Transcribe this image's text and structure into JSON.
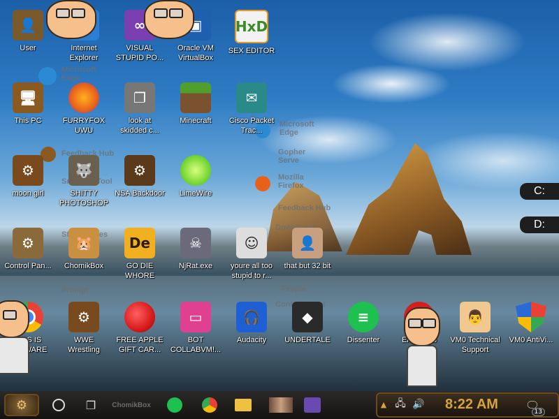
{
  "desktop_icons": [
    {
      "id": "user",
      "label": "User",
      "icon": "user-folder-icon",
      "color": "#7a5a2a"
    },
    {
      "id": "ie",
      "label": "Internet\nExplorer",
      "icon": "internet-explorer-icon",
      "color": "#2a7fd4"
    },
    {
      "id": "vs",
      "label": "VISUAL\nSTUPID PO...",
      "icon": "visual-studio-icon",
      "color": "#7a3fb0"
    },
    {
      "id": "vbox",
      "label": "Oracle VM\nVirtualBox",
      "icon": "virtualbox-icon",
      "color": "#1f5fb0"
    },
    {
      "id": "hxd",
      "label": "SEX EDITOR",
      "icon": "hex-editor-icon",
      "color": "#f2f2f2"
    },
    {
      "id": "thispc",
      "label": "This PC",
      "icon": "computer-icon",
      "color": "#8a5a20"
    },
    {
      "id": "firefox",
      "label": "FURRYFOX\nUWU",
      "icon": "firefox-icon",
      "color": "#e8611a"
    },
    {
      "id": "skidded",
      "label": "look at\nskidded c...",
      "icon": "stacked-windows-icon",
      "color": "#777777"
    },
    {
      "id": "minecraft",
      "label": "Minecraft",
      "icon": "grass-block-icon",
      "color": "#4f7f2a"
    },
    {
      "id": "cisco",
      "label": "Cisco Packet\nTrac...",
      "icon": "packet-tracer-icon",
      "color": "#2a8a8a"
    },
    {
      "id": "moongirl",
      "label": "moon girl",
      "icon": "steampunk-box-icon",
      "color": "#7a4a1f"
    },
    {
      "id": "gimp",
      "label": "SHITTY\nPHOTOSHOP",
      "icon": "gimp-icon",
      "color": "#6a6050"
    },
    {
      "id": "nsa",
      "label": "NSA Backdoor",
      "icon": "steampunk-gear-icon",
      "color": "#5a3a1a"
    },
    {
      "id": "limewire",
      "label": "LimeWire",
      "icon": "lime-icon",
      "color": "#6ad12a"
    },
    {
      "id": "cpanel",
      "label": "Control Pan...",
      "icon": "control-panel-icon",
      "color": "#8a6a3a"
    },
    {
      "id": "chomik",
      "label": "ChomikBox",
      "icon": "hamster-icon",
      "color": "#c89040"
    },
    {
      "id": "godie",
      "label": "GO DIE\nWHORE",
      "icon": "adobe-de-icon",
      "color": "#f0b020"
    },
    {
      "id": "njrat",
      "label": "NjRat.exe",
      "icon": "skull-icon",
      "color": "#6a6a7a"
    },
    {
      "id": "stupid",
      "label": "youre all too\nstupid to r...",
      "icon": "pixel-face-icon",
      "color": "#dddddd"
    },
    {
      "id": "32bit",
      "label": "that but 32 bit",
      "icon": "portrait-icon",
      "color": "#c8a080"
    },
    {
      "id": "spyware",
      "label": "THIS IS\nSPYWARE",
      "icon": "chrome-icon",
      "color": "#e94235"
    },
    {
      "id": "wwe",
      "label": "WWE\nWrestling",
      "icon": "steampunk-box-icon",
      "color": "#7a4a1f"
    },
    {
      "id": "apple",
      "label": "FREE APPLE\nGIFT CAR...",
      "icon": "apple-icon",
      "color": "#d81a1a"
    },
    {
      "id": "bot",
      "label": "BOT\nCOLLABVM!...",
      "icon": "monitor-icon",
      "color": "#e04090"
    },
    {
      "id": "audacity",
      "label": "Audacity",
      "icon": "headphones-icon",
      "color": "#1f5fd4"
    },
    {
      "id": "undertale",
      "label": "UNDERTALE",
      "icon": "unity-icon",
      "color": "#2a2a2a"
    },
    {
      "id": "dissenter",
      "label": "Dissenter",
      "icon": "chat-bubble-icon",
      "color": "#1ec050"
    },
    {
      "id": "errorzero",
      "label": "Error Zero\nD...",
      "icon": "error-icon",
      "color": "#d02020"
    },
    {
      "id": "vm0support",
      "label": "VM0 Technical\nSupport",
      "icon": "support-person-icon",
      "color": "#f0c890"
    },
    {
      "id": "vm0av",
      "label": "VM0 AntiVi...",
      "icon": "shield-icon",
      "color": "#2a6ad4"
    }
  ],
  "ghost_labels": {
    "microsoft_edge": "Microsoft\nEdge",
    "feedback_hub": "Feedback Hub",
    "snipping_tool": "Snipping Tool",
    "sticky_notes": "Sticky Notes",
    "prompt": "Prompt",
    "microsoft_edge_2": "Microsoft\nEdge",
    "gopher": "Gopher\nServe",
    "mozilla": "Mozilla\nFirefox",
    "feedback_hub_2": "Feedback Hub",
    "downloads": "Downloads",
    "people": "People",
    "control_panel": "Control Panel"
  },
  "drives": {
    "c": "C:",
    "d": "D:"
  },
  "taskbar": {
    "chomikbox_label": "ChomikBox",
    "clock": "8:22 AM",
    "notification_count": "13"
  }
}
